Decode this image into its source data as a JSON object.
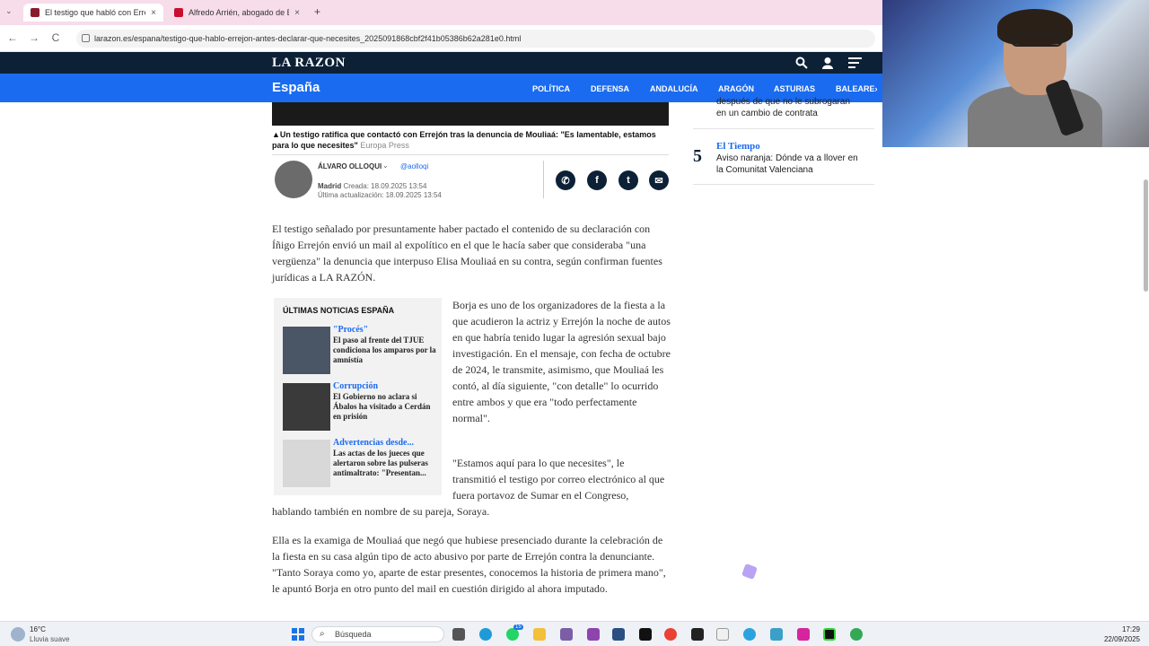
{
  "browser": {
    "tabs": [
      {
        "title": "El testigo que habló con Errejón",
        "active": true
      },
      {
        "title": "Alfredo Arrién, abogado de Eli",
        "active": false
      }
    ],
    "new_tab": "+",
    "close": "×",
    "back": "←",
    "forward": "→",
    "reload": "C",
    "url": "larazon.es/espana/testigo-que-hablo-errejon-antes-declarar-que-necesites_2025091868cbf2f41b05386b62a281e0.html"
  },
  "site": {
    "logo": "LA RAZON",
    "section": "España",
    "nav": [
      "POLÍTICA",
      "DEFENSA",
      "ANDALUCÍA",
      "ARAGÓN",
      "ASTURIAS",
      "BALEARE›"
    ]
  },
  "article": {
    "caption": "▲Un testigo ratifica que contactó con Errejón tras la denuncia de Mouliaá: \"Es lamentable, estamos para lo que necesites\"",
    "caption_credit": "Europa Press",
    "author": "ÁLVARO OLLOQUI",
    "handle": "@aolloqi",
    "location": "Madrid",
    "created": "Creada: 18.09.2025 13:54",
    "updated": "Última actualización: 18.09.2025 13:54",
    "share": [
      "whatsapp",
      "facebook",
      "twitter",
      "email"
    ],
    "paragraphs": [
      "El testigo señalado por presuntamente haber pactado el contenido de su declaración con Íñigo Errejón envió un mail al expolítico en el que le hacía saber que consideraba \"una vergüenza\" la denuncia que interpuso Elisa Mouliaá en su contra, según confirman fuentes jurídicas a LA RAZÓN.",
      "Borja es uno de los organizadores de la fiesta a la que acudieron la actriz y Errejón la noche de autos en que habría tenido lugar la agresión sexual bajo investigación. En el mensaje, con fecha de octubre de 2024, le transmite, asimismo, que Mouliaá les contó, al día siguiente, \"con detalle\" lo ocurrido entre ambos y que era \"todo perfectamente normal\".",
      "\"Estamos aquí para lo que necesites\", le transmitió el testigo por correo electrónico al que fuera portavoz de Sumar en el Congreso, hablando también en nombre de su pareja, Soraya.",
      "Ella es la examiga de Mouliaá que negó que hubiese presenciado durante la celebración de la fiesta en su casa algún tipo de acto abusivo por parte de Errejón contra la denunciante. \"Tanto Soraya como yo, aparte de estar presentes, conocemos la historia de primera mano\", le apuntó Borja en otro punto del mail en cuestión dirigido al ahora imputado."
    ]
  },
  "latest": {
    "title": "ÚLTIMAS NOTICIAS ESPAÑA",
    "items": [
      {
        "category": "\"Procés\"",
        "headline": "El paso al frente del TJUE condiciona los amparos por la amnistía"
      },
      {
        "category": "Corrupción",
        "headline": "El Gobierno no aclara si Ábalos ha visitado a Cerdán en prisión"
      },
      {
        "category": "Advertencias desde...",
        "headline": "Las actas de los jueces que alertaron sobre las pulseras antimaltrato: \"Presentan..."
      }
    ]
  },
  "rail": {
    "prev_tail_1": "después de que no le subrogaran",
    "prev_tail_2": "en un cambio de contrata",
    "rank": "5",
    "category": "El Tiempo",
    "headline_1": "Aviso naranja: Dónde va a llover en",
    "headline_2": "la Comunitat Valenciana"
  },
  "taskbar": {
    "weather_temp": "16°C",
    "weather_desc": "Lluvia suave",
    "search": "Búsqueda",
    "time": "17:29",
    "date": "22/09/2025",
    "badge": "15"
  },
  "colors": {
    "accent": "#1a6bf0",
    "header": "#0d2136"
  }
}
